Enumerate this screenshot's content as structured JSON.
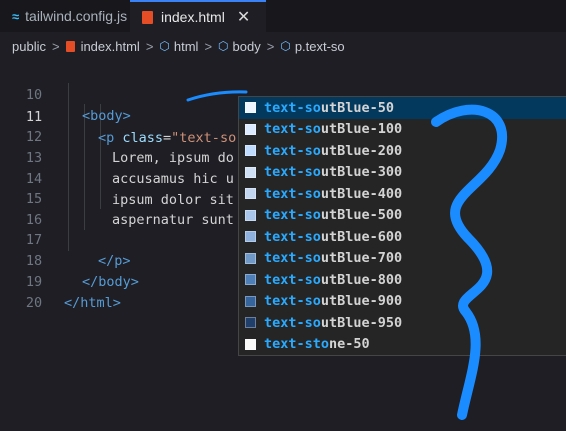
{
  "tabs": [
    {
      "label": "tailwind.config.js",
      "icon": "tailwind-icon"
    },
    {
      "label": "index.html",
      "icon": "html5-icon",
      "active": true,
      "close": "✕"
    }
  ],
  "breadcrumb": {
    "items": [
      "public",
      "index.html",
      "html",
      "body",
      "p.text-so"
    ],
    "separator": ">"
  },
  "editor": {
    "active_line": 11,
    "lines": [
      {
        "num": "10"
      },
      {
        "num": "11"
      },
      {
        "num": "12"
      },
      {
        "num": "13"
      },
      {
        "num": "14"
      },
      {
        "num": "15"
      },
      {
        "num": "16"
      },
      {
        "num": "17"
      },
      {
        "num": "18"
      },
      {
        "num": "19"
      },
      {
        "num": "20"
      }
    ],
    "code": {
      "l10_tag": "<body>",
      "l11_tag_open": "<p ",
      "l11_attr": "class",
      "l11_eq": "=",
      "l11_value": "\"text-so\"",
      "l11_tag_close": ">",
      "l12": "Lorem, ipsum do",
      "l13": "accusamus hic u",
      "l14": "ipsum dolor sit",
      "l15": "aspernatur sunt",
      "l17": "</p>",
      "l18": "</body>",
      "l19": "</html>"
    }
  },
  "suggestions": {
    "typed": "text-so",
    "items": [
      {
        "prefix": "text-so",
        "rest": "utBlue-50",
        "color": "#eff6ff"
      },
      {
        "prefix": "text-so",
        "rest": "utBlue-100",
        "color": "#dbeafe"
      },
      {
        "prefix": "text-so",
        "rest": "utBlue-200",
        "color": "#bfdbfe"
      },
      {
        "prefix": "text-so",
        "rest": "utBlue-300",
        "color": "#cfe0f4"
      },
      {
        "prefix": "text-so",
        "rest": "utBlue-400",
        "color": "#c2d6ef"
      },
      {
        "prefix": "text-so",
        "rest": "utBlue-500",
        "color": "#a9c6ea"
      },
      {
        "prefix": "text-so",
        "rest": "utBlue-600",
        "color": "#8fb1dd"
      },
      {
        "prefix": "text-so",
        "rest": "utBlue-700",
        "color": "#7099c8"
      },
      {
        "prefix": "text-so",
        "rest": "utBlue-800",
        "color": "#4e7fb6"
      },
      {
        "prefix": "text-so",
        "rest": "utBlue-900",
        "color": "#36649d"
      },
      {
        "prefix": "text-so",
        "rest": "utBlue-950",
        "color": "#213f6b"
      },
      {
        "prefix": "text-sto",
        "rest": "ne-50",
        "color": "#fafaf9"
      }
    ]
  },
  "colors": {
    "scribble": "#1a8cff",
    "match_highlight": "#2aaaff",
    "selection": "#04395e"
  }
}
